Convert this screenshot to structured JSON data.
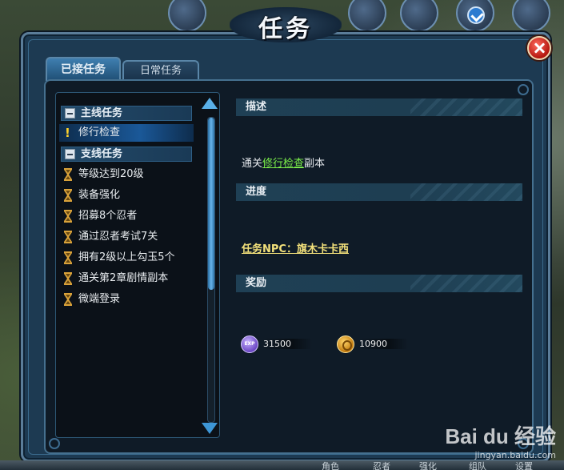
{
  "window": {
    "title": "任务"
  },
  "tabs": [
    {
      "label": "已接任务",
      "active": true
    },
    {
      "label": "日常任务",
      "active": false
    }
  ],
  "quest_list": {
    "main_category": "主线任务",
    "main_quests": [
      {
        "label": "修行检查",
        "selected": true,
        "icon": "exclaim-icon"
      }
    ],
    "side_category": "支线任务",
    "side_quests": [
      {
        "label": "等级达到20级",
        "icon": "hourglass-icon"
      },
      {
        "label": "装备强化",
        "icon": "hourglass-icon"
      },
      {
        "label": "招募8个忍者",
        "icon": "hourglass-icon"
      },
      {
        "label": "通过忍者考试7关",
        "icon": "hourglass-icon"
      },
      {
        "label": "拥有2级以上勾玉5个",
        "icon": "hourglass-icon"
      },
      {
        "label": "通关第2章剧情副本",
        "icon": "hourglass-icon"
      },
      {
        "label": "微端登录",
        "icon": "hourglass-icon"
      }
    ]
  },
  "detail": {
    "description_header": "描述",
    "description_prefix": "通关",
    "description_link": "修行检查",
    "description_suffix": "副本",
    "progress_header": "进度",
    "npc_link": "任务NPC：旗木卡卡西",
    "reward_header": "奖励",
    "rewards": [
      {
        "type": "exp",
        "icon_label": "EXP",
        "value": "31500"
      },
      {
        "type": "coin",
        "value": "10900"
      }
    ]
  },
  "bottom_bar": {
    "items": [
      "角色",
      "忍者",
      "强化",
      "组队",
      "设置"
    ]
  },
  "watermark": {
    "logo": "Bai du 经验",
    "url": "jingyan.baidu.com"
  },
  "colors": {
    "window_bg": "#1d3a52",
    "panel_bg": "#0f1b27",
    "quest_link": "#7cf04a",
    "npc_link": "#f2e07a",
    "selected_row": "#1a5898"
  }
}
